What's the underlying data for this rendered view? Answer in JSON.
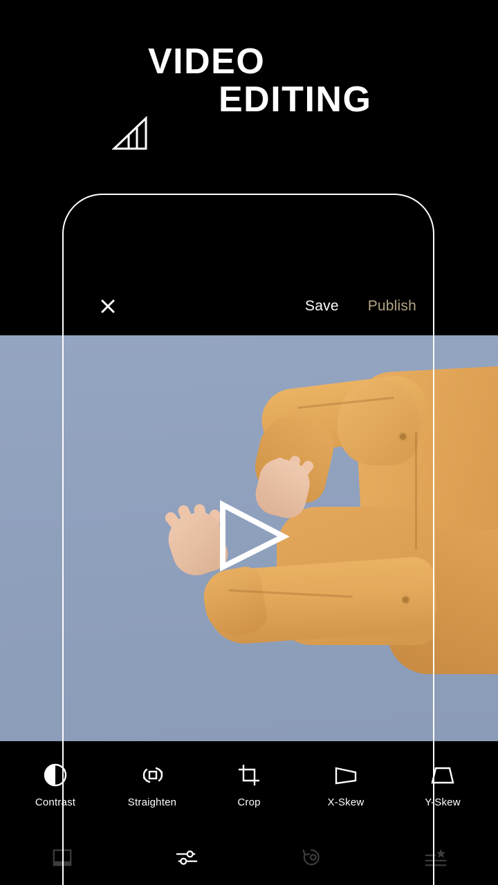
{
  "promo": {
    "title_line1": "VIDEO",
    "title_line2": "EDITING",
    "logo_icon": "bar-chart-triangle-logo"
  },
  "app": {
    "topbar": {
      "close_icon": "close-x-icon",
      "save_label": "Save",
      "publish_label": "Publish",
      "save_color": "#ffffff",
      "publish_color": "#b5a484"
    },
    "video": {
      "play_icon": "play-triangle-outline-icon",
      "sky_color": "#8fa0bd",
      "subject_color": "#dfa254",
      "skin_color": "#eac3a8"
    },
    "tools": [
      {
        "label": "Contrast",
        "icon": "contrast-icon",
        "active": false
      },
      {
        "label": "Straighten",
        "icon": "straighten-icon",
        "active": false
      },
      {
        "label": "Crop",
        "icon": "crop-icon",
        "active": false
      },
      {
        "label": "X-Skew",
        "icon": "x-skew-icon",
        "active": false
      },
      {
        "label": "Y-Skew",
        "icon": "y-skew-icon",
        "active": false
      }
    ],
    "bottom_nav": [
      {
        "name": "frame",
        "icon": "photo-frame-icon",
        "active": false
      },
      {
        "name": "adjust",
        "icon": "sliders-icon",
        "active": true
      },
      {
        "name": "revert",
        "icon": "revert-undo-icon",
        "active": false
      },
      {
        "name": "presets",
        "icon": "star-list-icon",
        "active": false
      }
    ],
    "colors": {
      "background": "#000000",
      "accent_gold": "#b5a484",
      "icon_active": "#ffffff",
      "icon_inactive": "#3c3c3c"
    }
  }
}
